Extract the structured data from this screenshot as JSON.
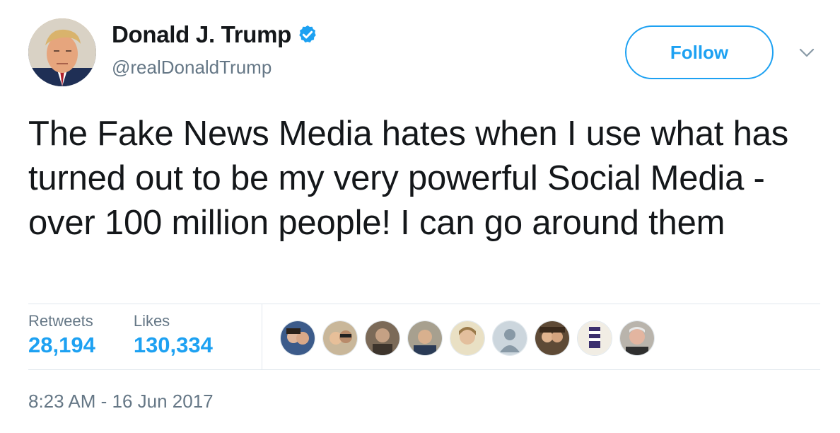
{
  "user": {
    "name": "Donald J. Trump",
    "handle": "@realDonaldTrump",
    "verified_icon": "verified-badge-icon"
  },
  "actions": {
    "follow_label": "Follow",
    "more_icon": "chevron-down-icon"
  },
  "tweet": {
    "text": "The Fake News Media hates when I use what has turned out to be my very powerful Social Media - over 100 million people! I can go around them"
  },
  "stats": {
    "retweets_label": "Retweets",
    "retweets_value": "28,194",
    "likes_label": "Likes",
    "likes_value": "130,334"
  },
  "timestamp": "8:23 AM - 16 Jun 2017",
  "colors": {
    "accent": "#1da1f2",
    "secondary_text": "#657786",
    "primary_text": "#14171a",
    "divider": "#e1e8ed"
  }
}
